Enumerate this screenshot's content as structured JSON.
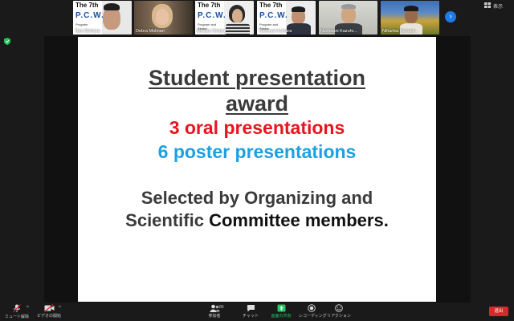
{
  "participants": [
    {
      "name": "Taro Demura",
      "logo_line1": "The 7th",
      "logo_line2": "P.C.W.",
      "logo_line3": "Program"
    },
    {
      "name": "Debra Molinari"
    },
    {
      "name": "Minako Omiya",
      "logo_line1": "The 7th",
      "logo_line2": "P.C.W.",
      "logo_line3": "Program and Abstra"
    },
    {
      "name": "Toshinori Kohara",
      "logo_line1": "The 7th",
      "logo_line2": "P.C.W.",
      "logo_line3": "Program and Abstra"
    },
    {
      "name": "Nishidani Kazuhi..."
    },
    {
      "name": "Niharika Nemavi..."
    }
  ],
  "top_right": {
    "view_label": "表示"
  },
  "slide": {
    "title_line1": "Student presentation",
    "title_line2": "award",
    "oral": "3 oral presentations",
    "poster": "6 poster presentations",
    "selected_line1": "Selected by Organizing and",
    "selected_line2_a": "Scientific ",
    "selected_line2_b": "Committee members."
  },
  "toolbar": {
    "unmute": "ミュート解除",
    "start_video": "ビデオの開始",
    "participants": "参加者",
    "participants_count": "80",
    "chat": "チャット",
    "share_screen": "画面の共有",
    "record": "レコーディング",
    "reactions": "リアクション",
    "end": "退出"
  },
  "colors": {
    "oral": "#e8141e",
    "poster": "#1ea0e0",
    "title": "#3a3a3a",
    "share_active": "#22c55e",
    "end_button": "#d42a2a"
  }
}
